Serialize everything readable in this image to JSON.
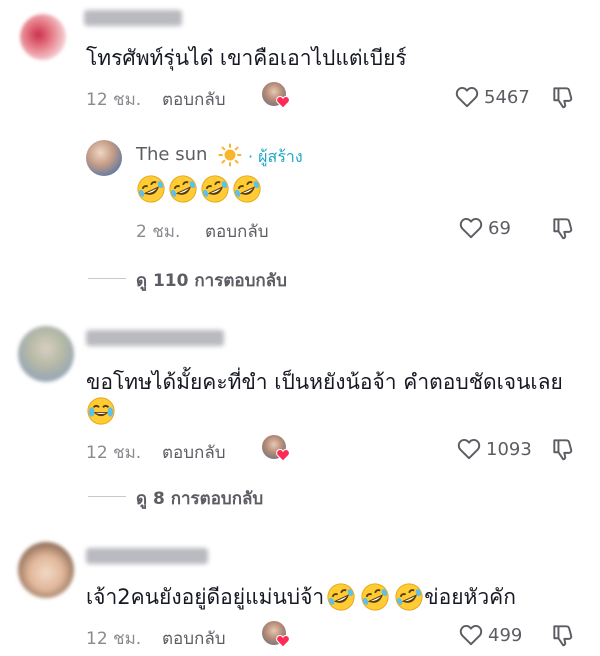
{
  "comments": [
    {
      "text": "โทรศัพท์รุ่นได๋ เขาคือเอาไปแต่เบียร์",
      "time": "12 ชม.",
      "reply_label": "ตอบกลับ",
      "likes": "5467",
      "creator_liked": true,
      "replies": [
        {
          "author": "The sun",
          "author_badge": "· ผู้สร้าง",
          "time": "2 ชม.",
          "reply_label": "ตอบกลับ",
          "likes": "69"
        }
      ],
      "view_replies": "ดู 110 การตอบกลับ"
    },
    {
      "text": "ขอโทษได้มั้ยคะที่ขำ เป็นหยังน้อจ้า คำตอบชัดเจนเลย",
      "time": "12 ชม.",
      "reply_label": "ตอบกลับ",
      "likes": "1093",
      "creator_liked": true,
      "view_replies": "ดู 8 การตอบกลับ"
    },
    {
      "text_before": "เจ้า2คนยังอยู่ดีอยู่แม่นบ่จ้า",
      "text_after": "ข่อยหัวคัก",
      "time": "12 ชม.",
      "reply_label": "ตอบกลับ",
      "likes": "499",
      "creator_liked": true
    }
  ],
  "colors": {
    "heart": "#fe2c55",
    "badge": "#20a8c8",
    "sun": "#f7b62d"
  },
  "icons": [
    "heart-outline-icon",
    "thumbs-down-icon",
    "rofl-emoji",
    "joy-emoji",
    "sun-emoji"
  ]
}
